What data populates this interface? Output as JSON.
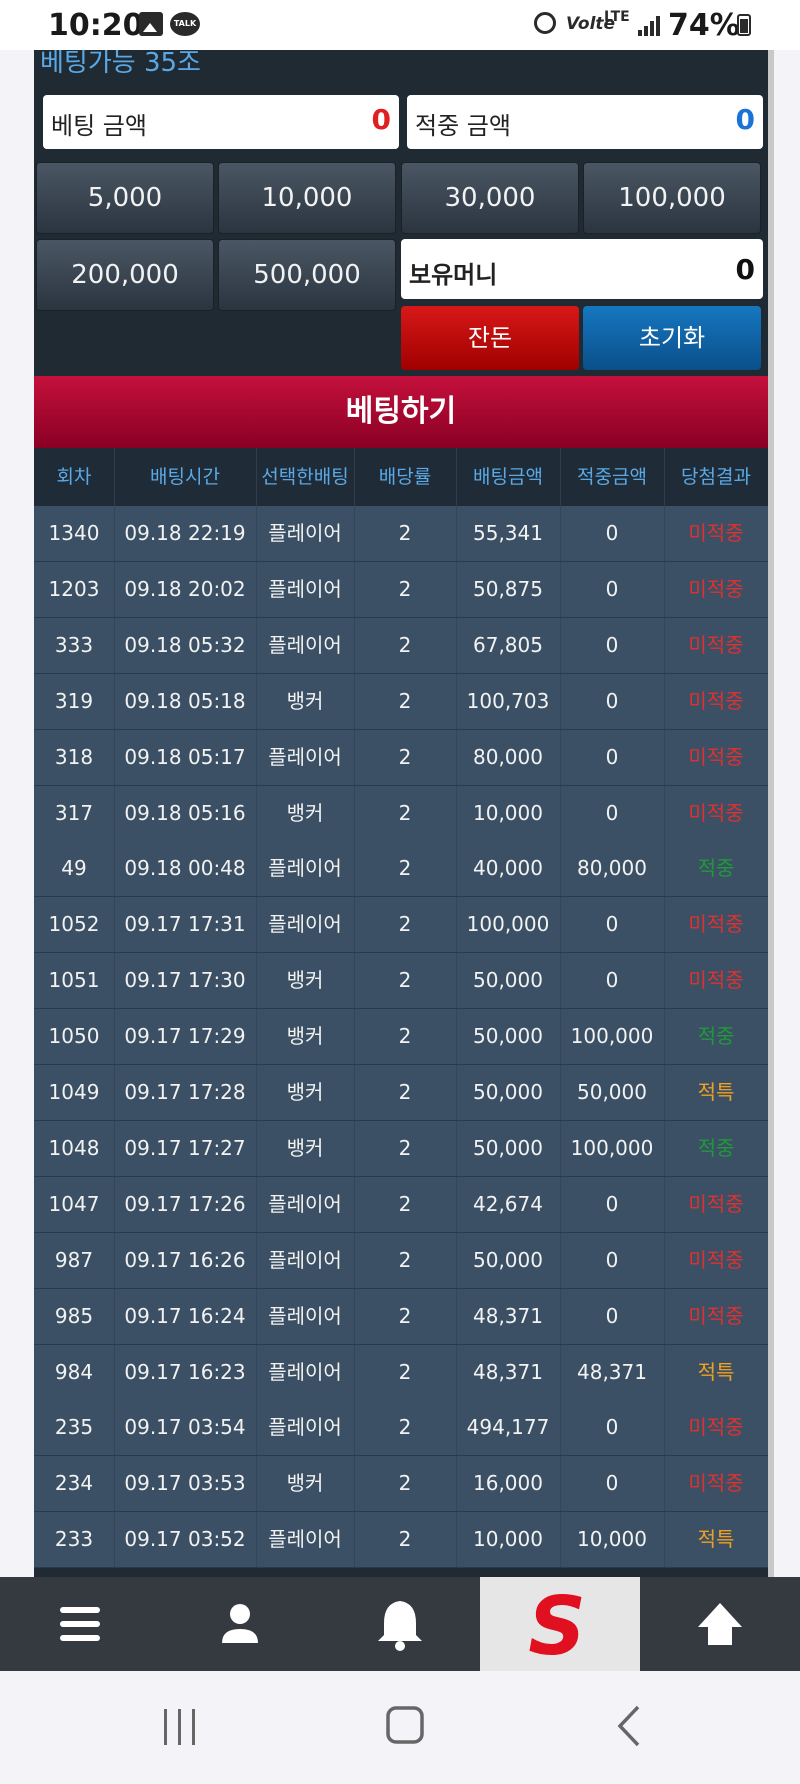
{
  "status_bar": {
    "time": "10:20",
    "talk_badge": "TALK",
    "volte": "Volte",
    "lte": "LTE",
    "battery": "74%",
    "icons": [
      "gallery-icon",
      "kakaotalk-icon",
      "alarm-icon",
      "volte-icon",
      "lte-icon",
      "signal-icon",
      "battery-icon"
    ]
  },
  "betting": {
    "available_text": "베팅가능 35조",
    "bet_amount_label": "베팅 금액",
    "bet_amount_value": "0",
    "win_amount_label": "적중 금액",
    "win_amount_value": "0",
    "chips": [
      "5,000",
      "10,000",
      "30,000",
      "100,000",
      "200,000",
      "500,000"
    ],
    "holding_label": "보유머니",
    "holding_value": "0",
    "change_button": "잔돈",
    "reset_button": "초기화",
    "submit_button": "베팅하기"
  },
  "history": {
    "columns": [
      "회차",
      "배팅시간",
      "선택한배팅",
      "배당률",
      "배팅금액",
      "적중금액",
      "당첨결과"
    ],
    "rows": [
      [
        "1340",
        "09.18 22:19",
        "플레이어",
        "2",
        "55,341",
        "0",
        "미적중"
      ],
      [
        "1203",
        "09.18 20:02",
        "플레이어",
        "2",
        "50,875",
        "0",
        "미적중"
      ],
      [
        "333",
        "09.18 05:32",
        "플레이어",
        "2",
        "67,805",
        "0",
        "미적중"
      ],
      [
        "319",
        "09.18 05:18",
        "뱅커",
        "2",
        "100,703",
        "0",
        "미적중"
      ],
      [
        "318",
        "09.18 05:17",
        "플레이어",
        "2",
        "80,000",
        "0",
        "미적중"
      ],
      [
        "317",
        "09.18 05:16",
        "뱅커",
        "2",
        "10,000",
        "0",
        "미적중"
      ],
      [
        "49",
        "09.18 00:48",
        "플레이어",
        "2",
        "40,000",
        "80,000",
        "적중"
      ],
      [
        "1052",
        "09.17 17:31",
        "플레이어",
        "2",
        "100,000",
        "0",
        "미적중"
      ],
      [
        "1051",
        "09.17 17:30",
        "뱅커",
        "2",
        "50,000",
        "0",
        "미적중"
      ],
      [
        "1050",
        "09.17 17:29",
        "뱅커",
        "2",
        "50,000",
        "100,000",
        "적중"
      ],
      [
        "1049",
        "09.17 17:28",
        "뱅커",
        "2",
        "50,000",
        "50,000",
        "적특"
      ],
      [
        "1048",
        "09.17 17:27",
        "뱅커",
        "2",
        "50,000",
        "100,000",
        "적중"
      ],
      [
        "1047",
        "09.17 17:26",
        "플레이어",
        "2",
        "42,674",
        "0",
        "미적중"
      ],
      [
        "987",
        "09.17 16:26",
        "플레이어",
        "2",
        "50,000",
        "0",
        "미적중"
      ],
      [
        "985",
        "09.17 16:24",
        "플레이어",
        "2",
        "48,371",
        "0",
        "미적중"
      ],
      [
        "984",
        "09.17 16:23",
        "플레이어",
        "2",
        "48,371",
        "48,371",
        "적특"
      ],
      [
        "235",
        "09.17 03:54",
        "플레이어",
        "2",
        "494,177",
        "0",
        "미적중"
      ],
      [
        "234",
        "09.17 03:53",
        "뱅커",
        "2",
        "16,000",
        "0",
        "미적중"
      ],
      [
        "233",
        "09.17 03:52",
        "플레이어",
        "2",
        "10,000",
        "10,000",
        "적특"
      ]
    ]
  },
  "bottom_nav": {
    "items": [
      "menu-icon",
      "user-icon",
      "bell-icon",
      "site-logo",
      "arrow-up-icon"
    ],
    "logo_letter": "S"
  },
  "system_nav": {
    "items": [
      "recent-apps-icon",
      "home-icon",
      "back-icon"
    ]
  },
  "colors": {
    "panel_bg": "#202a33",
    "row_bg": "#3b5064",
    "header_text": "#5aa9e6",
    "submit_red": "#b0002e",
    "lose": "#e03030",
    "win": "#1f9a3a",
    "special": "#f0a020"
  }
}
